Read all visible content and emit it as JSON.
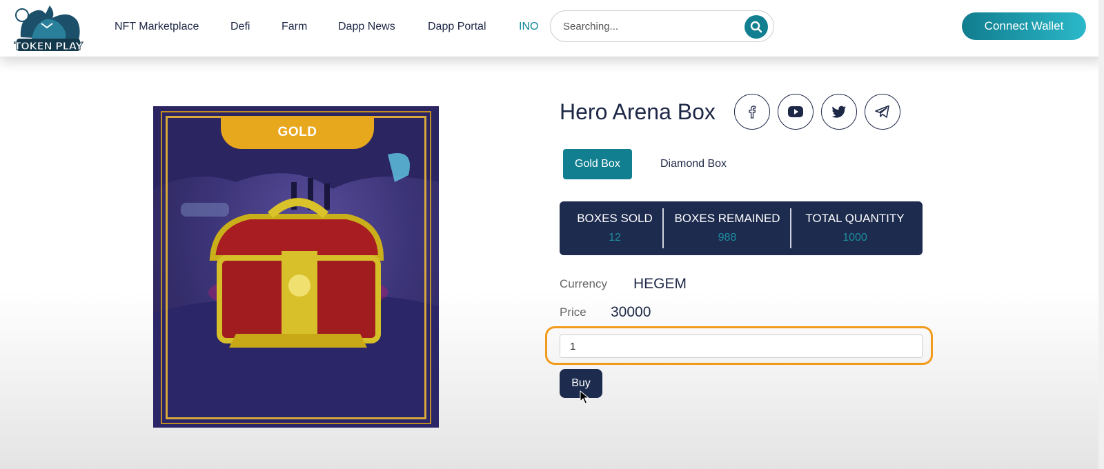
{
  "brand": {
    "logo_text": "TOKEN PLAY"
  },
  "nav": {
    "items": [
      {
        "label": "NFT Marketplace"
      },
      {
        "label": "Defi"
      },
      {
        "label": "Farm"
      },
      {
        "label": "Dapp News"
      },
      {
        "label": "Dapp Portal"
      },
      {
        "label": "INO",
        "active": true
      }
    ]
  },
  "search": {
    "placeholder": "Searching..."
  },
  "header": {
    "connect_label": "Connect Wallet"
  },
  "product": {
    "ribbon_label": "GOLD",
    "title": "Hero Arena Box",
    "social": [
      "facebook-icon",
      "youtube-icon",
      "twitter-icon",
      "telegram-icon"
    ],
    "tabs": [
      {
        "label": "Gold Box",
        "active": true
      },
      {
        "label": "Diamond Box",
        "active": false
      }
    ],
    "stats": [
      {
        "label": "BOXES SOLD",
        "value": "12"
      },
      {
        "label": "BOXES REMAINED",
        "value": "988"
      },
      {
        "label": "TOTAL QUANTITY",
        "value": "1000"
      }
    ],
    "currency_label": "Currency",
    "currency_value": "HEGEM",
    "price_label": "Price",
    "price_value": "30000",
    "quantity_value": "1",
    "buy_label": "Buy"
  },
  "colors": {
    "accent": "#117f90",
    "navy": "#1d2b4e",
    "highlight": "#f29a1a",
    "gold": "#e8a81e"
  }
}
